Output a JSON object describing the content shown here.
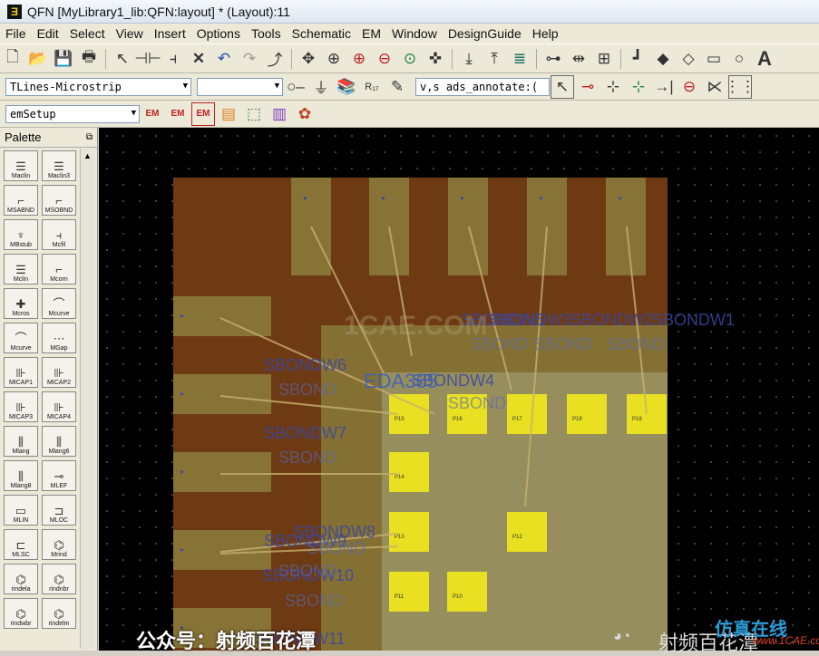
{
  "window": {
    "title": "QFN [MyLibrary1_lib:QFN:layout] * (Layout):11"
  },
  "menu": [
    "File",
    "Edit",
    "Select",
    "View",
    "Insert",
    "Options",
    "Tools",
    "Schematic",
    "EM",
    "Window",
    "DesignGuide",
    "Help"
  ],
  "toolbar2": {
    "library_combo": "TLines-Microstrip",
    "component_combo": "",
    "net_combo": "v,s ads_annotate:("
  },
  "toolbar3": {
    "em_combo": "emSetup",
    "em_labels": [
      "EM",
      "EM",
      "EM"
    ]
  },
  "palette": {
    "title": "Palette",
    "items": [
      {
        "label": "Maclin",
        "icon": "coupled-lines-icon"
      },
      {
        "label": "Maclin3",
        "icon": "coupled-lines-icon"
      },
      {
        "label": "MSABND",
        "icon": "bend-icon"
      },
      {
        "label": "MSOBND",
        "icon": "bend-icon"
      },
      {
        "label": "MBstub",
        "icon": "stub-icon"
      },
      {
        "label": "Mcfil",
        "icon": "filter-icon"
      },
      {
        "label": "Mclin",
        "icon": "coupled-lines-icon"
      },
      {
        "label": "Mcorn",
        "icon": "corner-icon"
      },
      {
        "label": "Mcros",
        "icon": "cross-icon"
      },
      {
        "label": "Mcurve",
        "icon": "curve-icon"
      },
      {
        "label": "Mcurve",
        "icon": "curve-icon"
      },
      {
        "label": "MGap",
        "icon": "gap-icon"
      },
      {
        "label": "MICAP1",
        "icon": "capacitor-icon"
      },
      {
        "label": "MICAP2",
        "icon": "capacitor-icon"
      },
      {
        "label": "MICAP3",
        "icon": "capacitor-icon"
      },
      {
        "label": "MICAP4",
        "icon": "capacitor-icon"
      },
      {
        "label": "Mlang",
        "icon": "lange-icon"
      },
      {
        "label": "Mlang6",
        "icon": "lange-icon"
      },
      {
        "label": "Mlang8",
        "icon": "lange-icon"
      },
      {
        "label": "MLEF",
        "icon": "open-end-icon"
      },
      {
        "label": "MLIN",
        "icon": "line-icon"
      },
      {
        "label": "MLOC",
        "icon": "open-stub-icon"
      },
      {
        "label": "MLSC",
        "icon": "short-stub-icon"
      },
      {
        "label": "Mrind",
        "icon": "inductor-icon"
      },
      {
        "label": "rindela",
        "icon": "inductor-icon"
      },
      {
        "label": "rindnbr",
        "icon": "inductor-icon"
      },
      {
        "label": "rindwbr",
        "icon": "inductor-icon"
      },
      {
        "label": "rindelm",
        "icon": "inductor-icon"
      }
    ]
  },
  "layout": {
    "bondwire_labels": [
      "SBONDW1",
      "SBONDW2",
      "SBONDW3",
      "SBONDW4",
      "SBONDW5",
      "SBONDW6",
      "SBONDW7",
      "SBONDW8",
      "SBONDW9",
      "SBONDW10",
      "SBONDW11"
    ],
    "component_labels": [
      "SBOND",
      "SBOND",
      "SBOND",
      "SBOND",
      "SBOND",
      "SBOND",
      "SBOND",
      "SBOND",
      "SBOND"
    ],
    "pad_labels": [
      "P18",
      "P19",
      "P17",
      "P16",
      "P15",
      "P14",
      "P13",
      "P12",
      "P11",
      "P10"
    ],
    "overlay_text": "EDA365",
    "watermark_text": "1CAE.COM",
    "colors": {
      "substrate": "#6e3a14",
      "lead": "#8a7a3a",
      "die": "#9a9668",
      "pad": "#e8e020",
      "bondwire": "#c8b070",
      "label": "#3a48a0"
    }
  },
  "footer": {
    "caption": "公众号：射频百花潭",
    "wechat_label": "射频百花潭",
    "brand": "仿真在线",
    "brand_url": "www.1CAE.com"
  }
}
